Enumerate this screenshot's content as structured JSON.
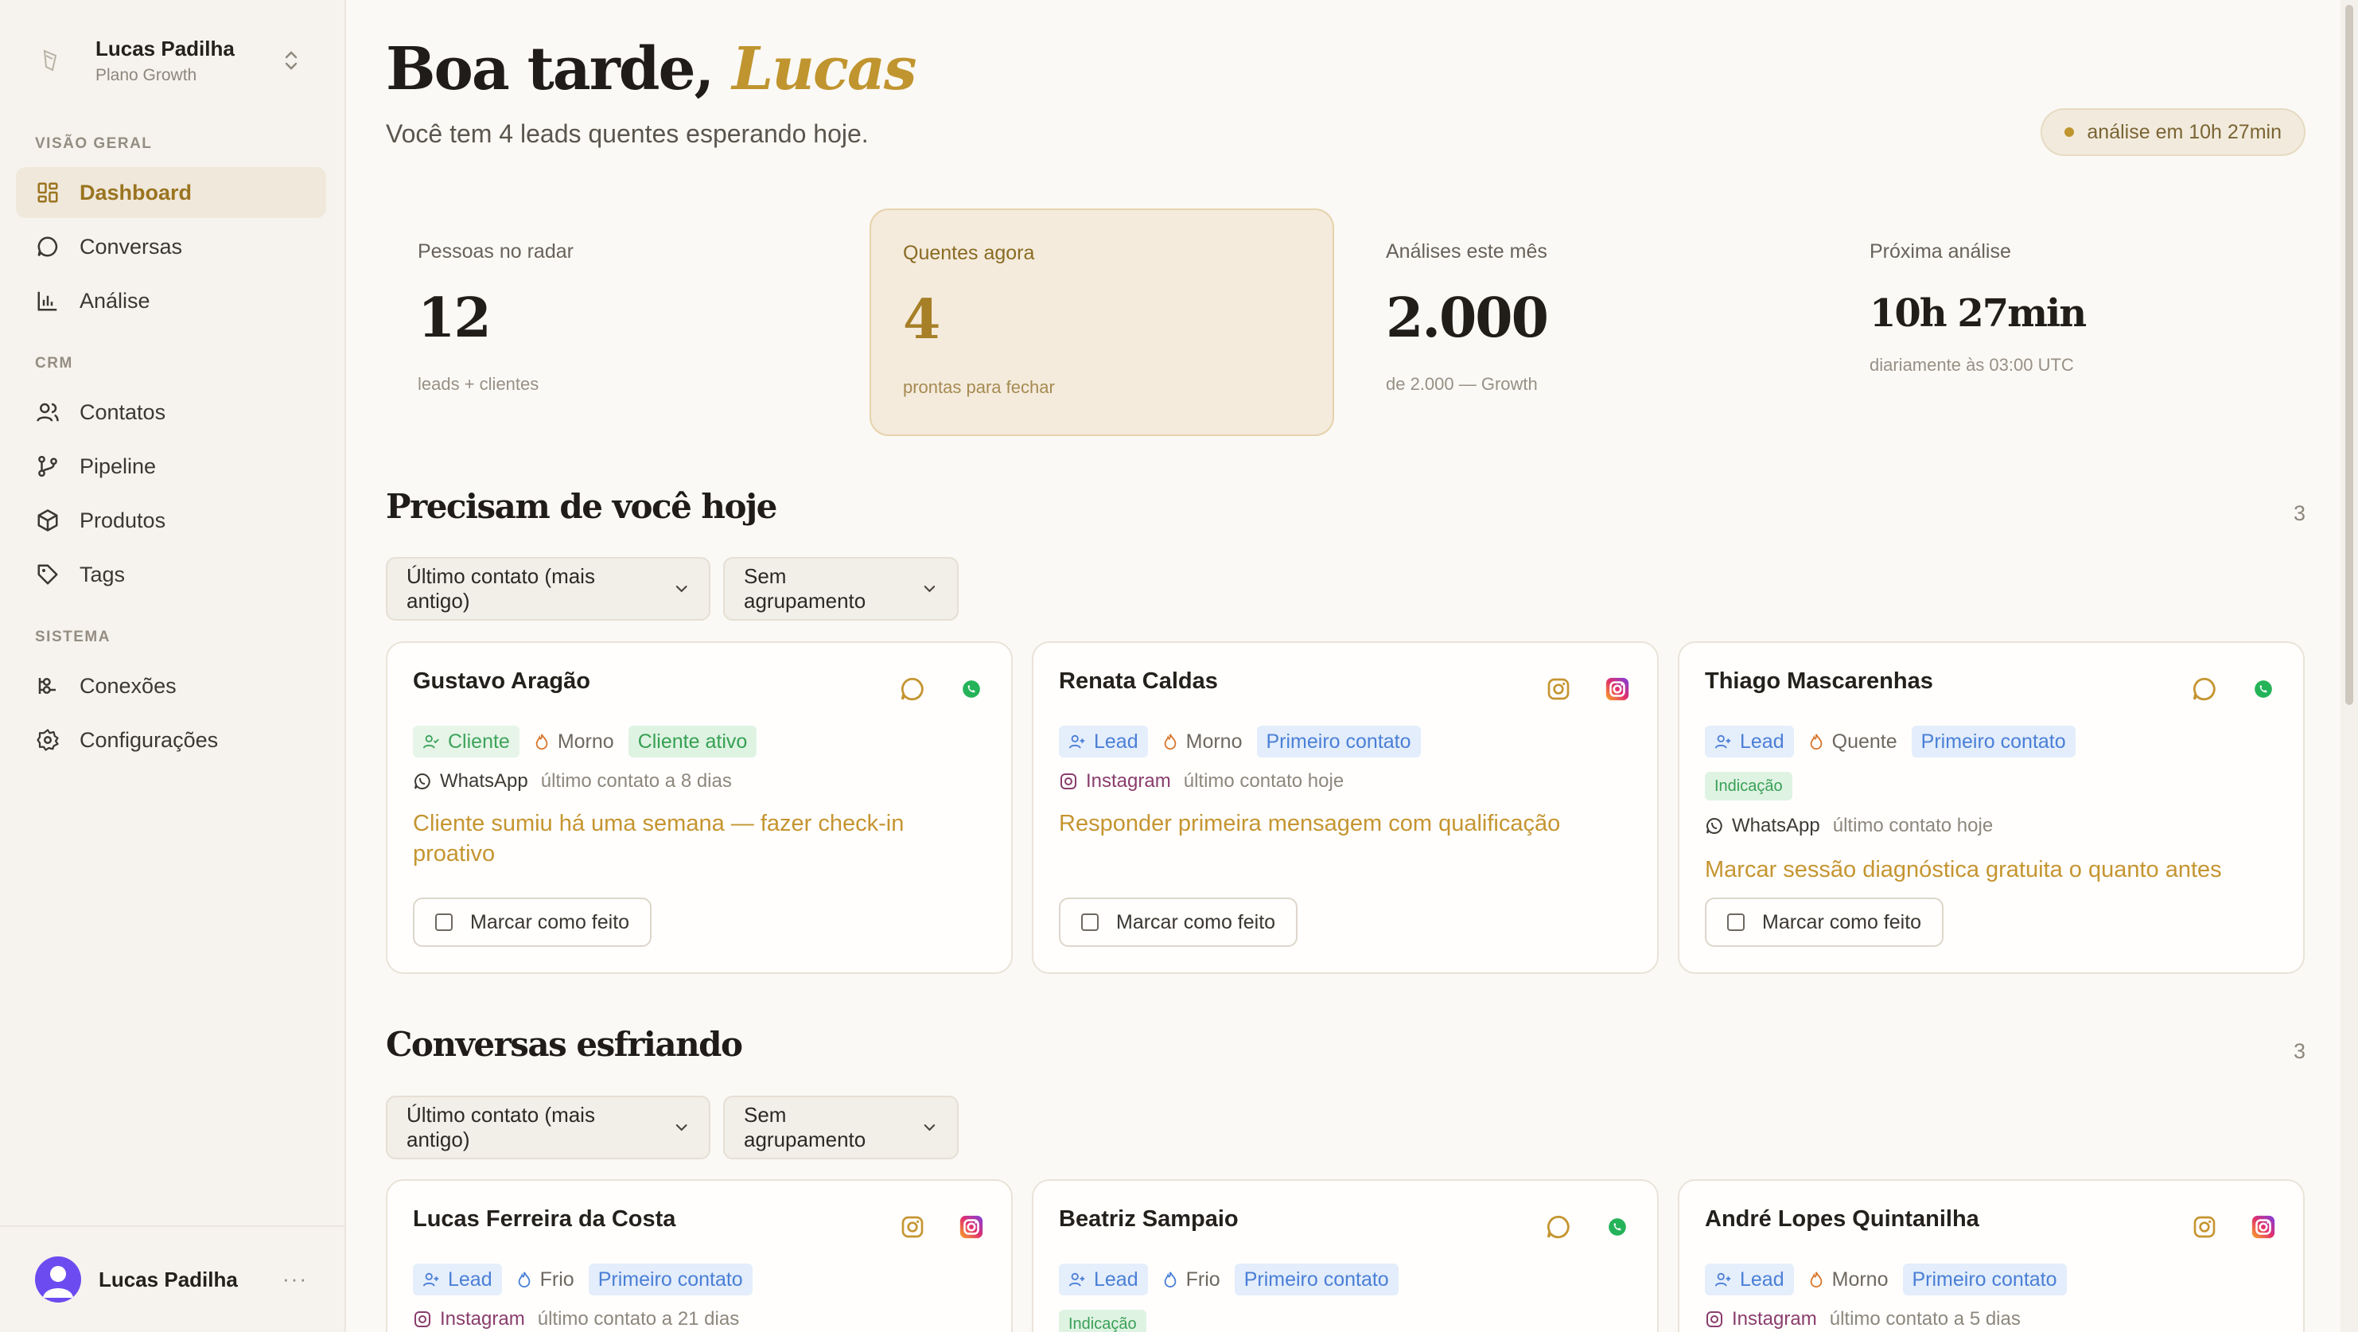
{
  "workspace": {
    "name": "Lucas Padilha",
    "plan": "Plano Growth"
  },
  "sidebar": {
    "sections": [
      "VISÃO GERAL",
      "CRM",
      "SISTEMA"
    ],
    "items": [
      {
        "label": "Dashboard",
        "icon": "dashboard-icon"
      },
      {
        "label": "Conversas",
        "icon": "chat-icon"
      },
      {
        "label": "Análise",
        "icon": "bar-chart-icon"
      },
      {
        "label": "Contatos",
        "icon": "users-icon"
      },
      {
        "label": "Pipeline",
        "icon": "pipeline-icon"
      },
      {
        "label": "Produtos",
        "icon": "box-icon"
      },
      {
        "label": "Tags",
        "icon": "tag-icon"
      },
      {
        "label": "Conexões",
        "icon": "link-icon"
      },
      {
        "label": "Configurações",
        "icon": "gear-icon"
      }
    ],
    "user": {
      "name": "Lucas Padilha",
      "more": "···"
    }
  },
  "header": {
    "greeting": "Boa tarde,",
    "name": "Lucas",
    "subtitle": "Você tem 4 leads quentes esperando hoje.",
    "status_pill": "análise em 10h 27min"
  },
  "stats": [
    {
      "label": "Pessoas no radar",
      "value": "12",
      "caption": "leads + clientes"
    },
    {
      "label": "Quentes agora",
      "value": "4",
      "caption": "prontas para fechar"
    },
    {
      "label": "Análises este mês",
      "value": "2.000",
      "caption": "de 2.000 — Growth"
    },
    {
      "label": "Próxima análise",
      "value": "10h 27min",
      "caption": "diariamente às 03:00 UTC"
    }
  ],
  "sections": [
    {
      "title": "Precisam de você hoje",
      "count": "3",
      "sort": "Último contato (mais antigo)",
      "group": "Sem agrupamento",
      "cards": [
        {
          "name": "Gustavo Aragão",
          "type": "Cliente",
          "temp": "Morno",
          "stage": "Cliente ativo",
          "channel": "WhatsApp",
          "last": "último contato a 8 dias",
          "task": "Cliente sumiu há uma semana — fazer check-in proativo",
          "action": "Marcar como feito"
        },
        {
          "name": "Renata Caldas",
          "type": "Lead",
          "temp": "Morno",
          "stage": "Primeiro contato",
          "channel": "Instagram",
          "last": "último contato hoje",
          "task": "Responder primeira mensagem com qualificação",
          "action": "Marcar como feito"
        },
        {
          "name": "Thiago Mascarenhas",
          "type": "Lead",
          "temp": "Quente",
          "stage": "Primeiro contato",
          "extra_tag": "Indicação",
          "channel": "WhatsApp",
          "last": "último contato hoje",
          "task": "Marcar sessão diagnóstica gratuita o quanto antes",
          "action": "Marcar como feito"
        }
      ]
    },
    {
      "title": "Conversas esfriando",
      "count": "3",
      "sort": "Último contato (mais antigo)",
      "group": "Sem agrupamento",
      "cards": [
        {
          "name": "Lucas Ferreira da Costa",
          "type": "Lead",
          "temp": "Frio",
          "stage": "Primeiro contato",
          "channel": "Instagram",
          "last": "último contato a 21 dias"
        },
        {
          "name": "Beatriz Sampaio",
          "type": "Lead",
          "temp": "Frio",
          "stage": "Primeiro contato",
          "extra_tag": "Indicação"
        },
        {
          "name": "André Lopes Quintanilha",
          "type": "Lead",
          "temp": "Morno",
          "stage": "Primeiro contato",
          "channel": "Instagram",
          "last": "último contato a 5 dias"
        }
      ]
    }
  ],
  "colors": {
    "accent": "#c0952f",
    "sidebar_bg": "#f6f3ee",
    "page_bg": "#fbf9f5",
    "whatsapp": "#25b35a",
    "lead_blue": "#4a7fd6"
  }
}
